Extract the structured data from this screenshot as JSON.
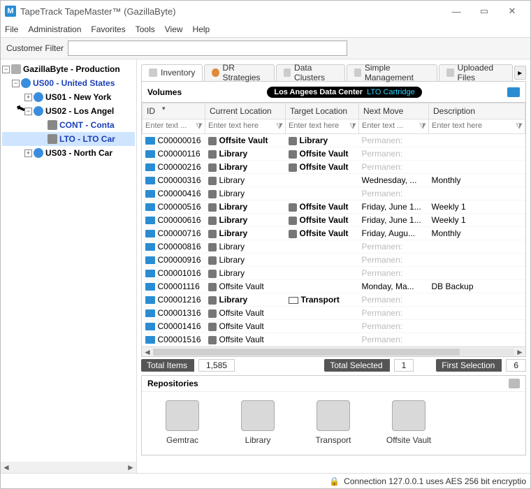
{
  "window": {
    "title": "TapeTrack TapeMaster™ (GazillaByte)",
    "appicon_letter": "M"
  },
  "menu": {
    "file": "File",
    "admin": "Administration",
    "fav": "Favorites",
    "tools": "Tools",
    "view": "View",
    "help": "Help"
  },
  "filter": {
    "label": "Customer Filter",
    "value": ""
  },
  "tree": {
    "root": "GazillaByte - Production",
    "us00": "US00 - United States",
    "us01": "US01 - New York",
    "us02": "US02 - Los Angel",
    "cont": "CONT - Conta",
    "lto": "LTO - LTO Car",
    "us03": "US03 - North Car"
  },
  "tabs": {
    "inventory": "Inventory",
    "dr": "DR Strategies",
    "clusters": "Data Clusters",
    "simple": "Simple Management",
    "uploaded": "Uploaded Files"
  },
  "volumes": {
    "title": "Volumes",
    "pill_loc": "Los Angees Data Center",
    "pill_media": "LTO Cartridge"
  },
  "columns": {
    "id": "ID",
    "cur": "Current Location",
    "tgt": "Target Location",
    "next": "Next Move",
    "desc": "Description"
  },
  "filters_ph": {
    "short": "Enter text ...",
    "long": "Enter text here"
  },
  "rows": [
    {
      "id": "C00000016",
      "cur": "Offsite Vault",
      "cur_b": true,
      "tgt": "Library",
      "tgt_b": true,
      "next": "Permanen:",
      "next_f": true,
      "desc": ""
    },
    {
      "id": "C00000116",
      "cur": "Library",
      "cur_b": true,
      "tgt": "Offsite Vault",
      "tgt_b": true,
      "next": "Permanen:",
      "next_f": true,
      "desc": ""
    },
    {
      "id": "C00000216",
      "cur": "Library",
      "cur_b": true,
      "tgt": "Offsite Vault",
      "tgt_b": true,
      "next": "Permanen:",
      "next_f": true,
      "desc": ""
    },
    {
      "id": "C00000316",
      "cur": "Library",
      "cur_b": false,
      "tgt": "",
      "tgt_b": false,
      "next": "Wednesday, ...",
      "next_f": false,
      "desc": "Monthly"
    },
    {
      "id": "C00000416",
      "cur": "Library",
      "cur_b": false,
      "tgt": "",
      "tgt_b": false,
      "next": "Permanen:",
      "next_f": true,
      "desc": ""
    },
    {
      "id": "C00000516",
      "cur": "Library",
      "cur_b": true,
      "tgt": "Offsite Vault",
      "tgt_b": true,
      "next": "Friday, June 1...",
      "next_f": false,
      "desc": "Weekly 1"
    },
    {
      "id": "C00000616",
      "cur": "Library",
      "cur_b": true,
      "tgt": "Offsite Vault",
      "tgt_b": true,
      "next": "Friday, June 1...",
      "next_f": false,
      "desc": "Weekly 1"
    },
    {
      "id": "C00000716",
      "cur": "Library",
      "cur_b": true,
      "tgt": "Offsite Vault",
      "tgt_b": true,
      "next": "Friday, Augu...",
      "next_f": false,
      "desc": "Monthly"
    },
    {
      "id": "C00000816",
      "cur": "Library",
      "cur_b": false,
      "tgt": "",
      "tgt_b": false,
      "next": "Permanen:",
      "next_f": true,
      "desc": ""
    },
    {
      "id": "C00000916",
      "cur": "Library",
      "cur_b": false,
      "tgt": "",
      "tgt_b": false,
      "next": "Permanen:",
      "next_f": true,
      "desc": ""
    },
    {
      "id": "C00001016",
      "cur": "Library",
      "cur_b": false,
      "tgt": "",
      "tgt_b": false,
      "next": "Permanen:",
      "next_f": true,
      "desc": ""
    },
    {
      "id": "C00001116",
      "cur": "Offsite Vault",
      "cur_b": false,
      "tgt": "",
      "tgt_b": false,
      "next": "Monday, Ma...",
      "next_f": false,
      "desc": "DB Backup"
    },
    {
      "id": "C00001216",
      "cur": "Library",
      "cur_b": true,
      "tgt": "Transport",
      "tgt_b": true,
      "tgt_truck": true,
      "next": "Permanen:",
      "next_f": true,
      "desc": ""
    },
    {
      "id": "C00001316",
      "cur": "Offsite Vault",
      "cur_b": false,
      "tgt": "",
      "tgt_b": false,
      "next": "Permanen:",
      "next_f": true,
      "desc": ""
    },
    {
      "id": "C00001416",
      "cur": "Offsite Vault",
      "cur_b": false,
      "tgt": "",
      "tgt_b": false,
      "next": "Permanen:",
      "next_f": true,
      "desc": ""
    },
    {
      "id": "C00001516",
      "cur": "Offsite Vault",
      "cur_b": false,
      "tgt": "",
      "tgt_b": false,
      "next": "Permanen:",
      "next_f": true,
      "desc": ""
    }
  ],
  "status": {
    "total_items_l": "Total Items",
    "total_items_v": "1,585",
    "total_sel_l": "Total Selected",
    "total_sel_v": "1",
    "first_sel_l": "First Selection",
    "first_sel_v": "6"
  },
  "repos": {
    "title": "Repositories",
    "items": [
      "Gemtrac",
      "Library",
      "Transport",
      "Offsite Vault"
    ]
  },
  "footer": {
    "text": "Connection 127.0.0.1 uses AES 256 bit encryptio"
  }
}
